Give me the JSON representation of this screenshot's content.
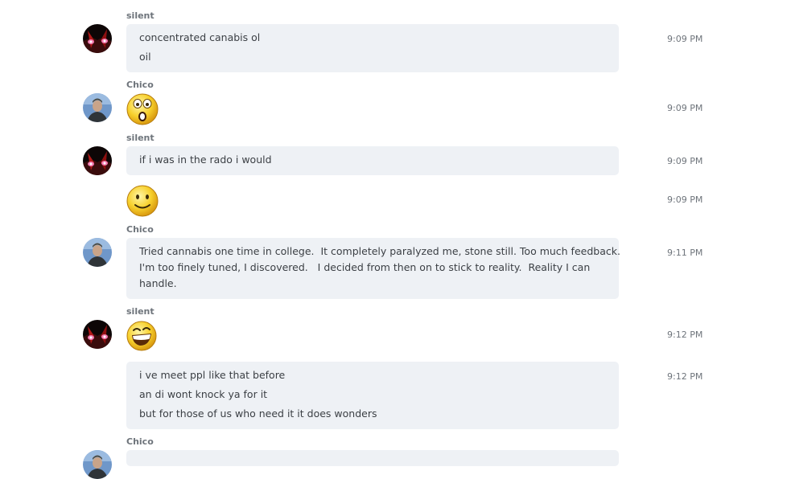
{
  "messages": [
    {
      "sender": "silent",
      "lines": [
        "concentrated canabis ol",
        "oil"
      ],
      "time": "9:09 PM"
    },
    {
      "sender": "Chico",
      "emoji": "surprised-emoji",
      "time": "9:09 PM"
    },
    {
      "sender": "silent",
      "lines": [
        "if i was in the rado i would"
      ],
      "time": "9:09 PM"
    },
    {
      "emoji": "smile-emoji",
      "time": "9:09 PM"
    },
    {
      "sender": "Chico",
      "lines": [
        "Tried cannabis one time in college.  It completely paralyzed me, stone still. Too much feedback.",
        "I'm too finely tuned, I discovered.   I decided from then on to stick to reality.  Reality I can",
        "handle."
      ],
      "time": "9:11 PM"
    },
    {
      "sender": "silent",
      "emoji": "laugh-emoji",
      "time": "9:12 PM"
    },
    {
      "lines": [
        "i ve meet ppl like that before",
        "an di wont knock ya for it",
        "but for those of us who need it it does wonders"
      ],
      "time": "9:12 PM"
    },
    {
      "sender": "Chico"
    }
  ],
  "colors": {
    "bubble": "#eef1f5",
    "sender": "#6e747b",
    "text": "#3b3f44"
  }
}
